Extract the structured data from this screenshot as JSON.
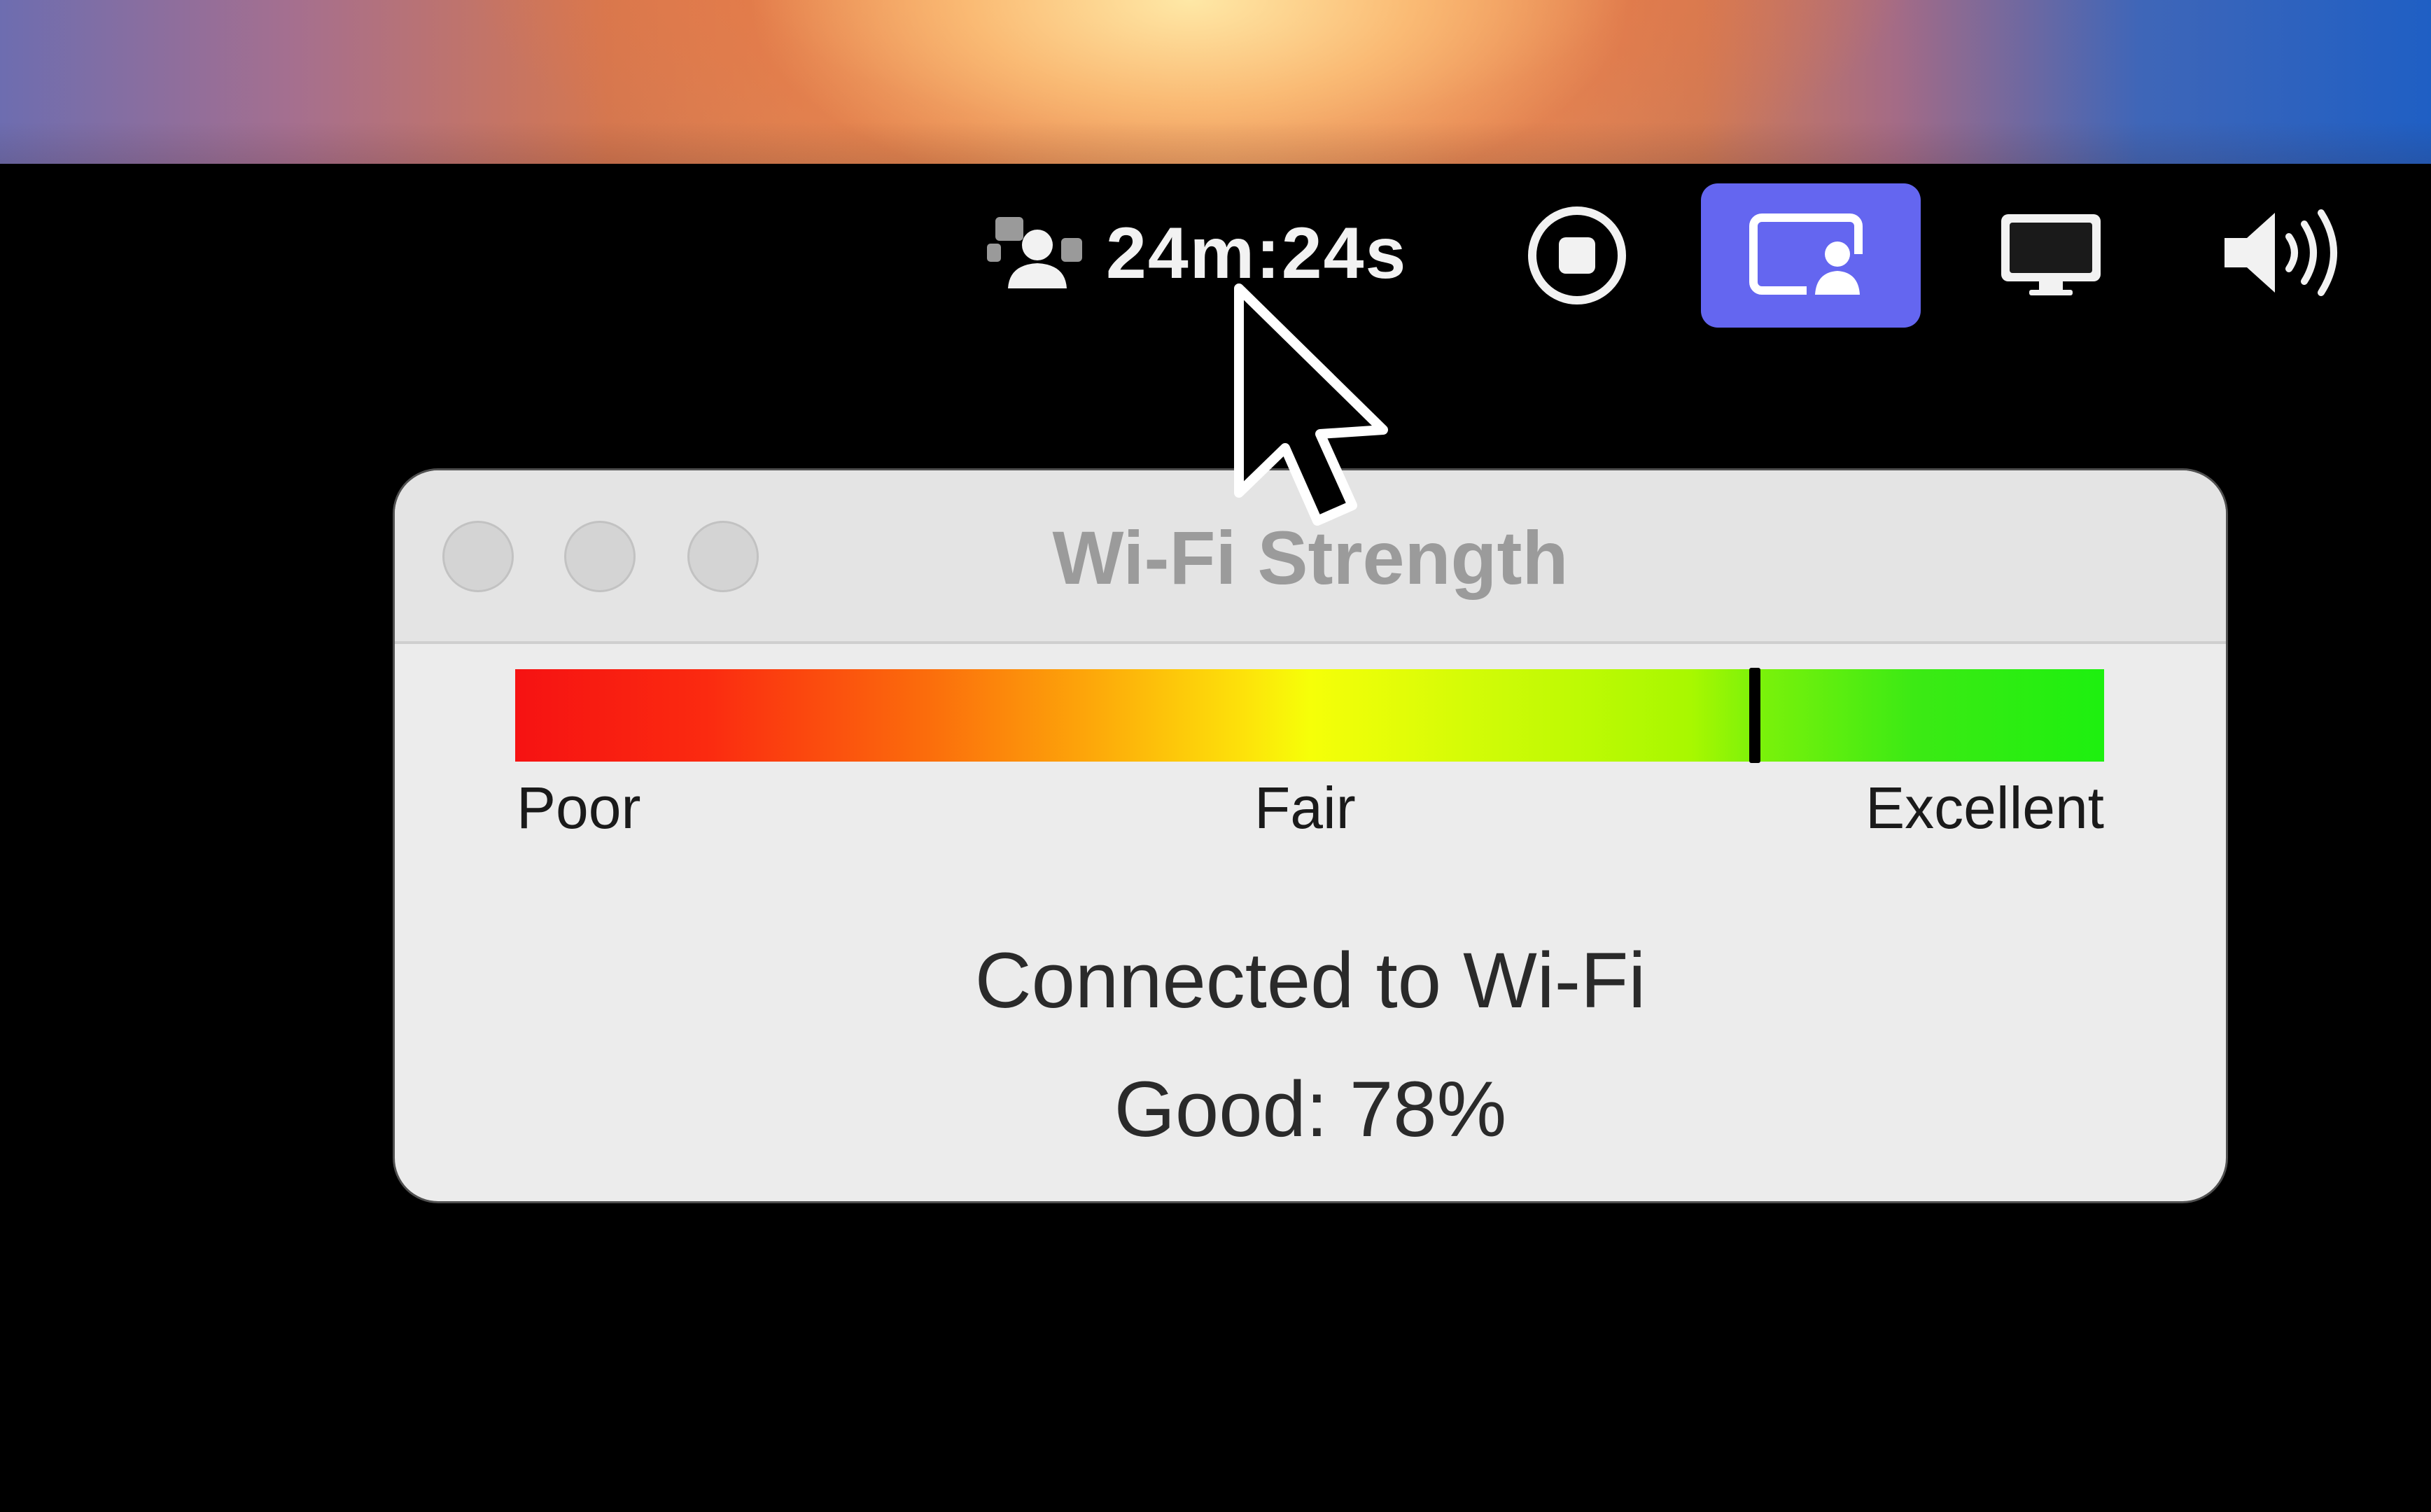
{
  "menubar": {
    "session_timer": "24m:24s",
    "icons": {
      "participants": "participants-icon",
      "stop": "stop-record-icon",
      "screen_share": "screen-share-icon",
      "display": "display-icon",
      "volume": "volume-icon"
    },
    "accent_color": "#6466f0"
  },
  "dialog": {
    "title": "Wi-Fi Strength",
    "meter": {
      "labels": {
        "poor": "Poor",
        "fair": "Fair",
        "excellent": "Excellent"
      },
      "value_fraction": 0.78
    },
    "status": "Connected to Wi-Fi",
    "strength_text": "Good: 78%"
  }
}
